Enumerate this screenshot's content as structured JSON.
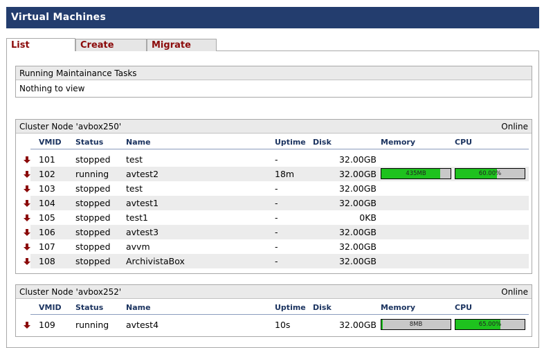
{
  "page": {
    "title": "Virtual Machines"
  },
  "tabs": [
    {
      "label": "List",
      "active": true
    },
    {
      "label": "Create",
      "active": false
    },
    {
      "label": "Migrate",
      "active": false
    }
  ],
  "maintenance": {
    "title": "Running Maintainance Tasks",
    "empty_text": "Nothing to view"
  },
  "columns": {
    "vmid": "VMID",
    "status": "Status",
    "name": "Name",
    "uptime": "Uptime",
    "disk": "Disk",
    "memory": "Memory",
    "cpu": "CPU"
  },
  "colors": {
    "titlebar": "#233d6e",
    "tab_text": "#8b0a0a",
    "bar_fill": "#1ec21e",
    "bar_bg": "#c8c8c8",
    "arrow": "#8b0a0a"
  },
  "clusters": [
    {
      "title": "Cluster Node 'avbox250'",
      "status": "Online",
      "vms": [
        {
          "icon": "down-arrow-icon",
          "vmid": "101",
          "status": "stopped",
          "name": "test",
          "uptime": "-",
          "disk": "32.00GB"
        },
        {
          "icon": "down-arrow-icon",
          "vmid": "102",
          "status": "running",
          "name": "avtest2",
          "uptime": "18m",
          "disk": "32.00GB",
          "memory": {
            "label": "435MB",
            "fraction": 0.85
          },
          "cpu": {
            "label": "60.00%",
            "fraction": 0.6
          }
        },
        {
          "icon": "down-arrow-icon",
          "vmid": "103",
          "status": "stopped",
          "name": "test",
          "uptime": "-",
          "disk": "32.00GB"
        },
        {
          "icon": "down-arrow-icon",
          "vmid": "104",
          "status": "stopped",
          "name": "avtest1",
          "uptime": "-",
          "disk": "32.00GB"
        },
        {
          "icon": "down-arrow-icon",
          "vmid": "105",
          "status": "stopped",
          "name": "test1",
          "uptime": "-",
          "disk": "0KB"
        },
        {
          "icon": "down-arrow-icon",
          "vmid": "106",
          "status": "stopped",
          "name": "avtest3",
          "uptime": "-",
          "disk": "32.00GB"
        },
        {
          "icon": "down-arrow-icon",
          "vmid": "107",
          "status": "stopped",
          "name": "avvm",
          "uptime": "-",
          "disk": "32.00GB"
        },
        {
          "icon": "down-arrow-icon",
          "vmid": "108",
          "status": "stopped",
          "name": "ArchivistaBox",
          "uptime": "-",
          "disk": "32.00GB"
        }
      ]
    },
    {
      "title": "Cluster Node 'avbox252'",
      "status": "Online",
      "vms": [
        {
          "icon": "down-arrow-icon",
          "vmid": "109",
          "status": "running",
          "name": "avtest4",
          "uptime": "10s",
          "disk": "32.00GB",
          "memory": {
            "label": "8MB",
            "fraction": 0.02
          },
          "cpu": {
            "label": "65.00%",
            "fraction": 0.65
          }
        }
      ]
    }
  ]
}
